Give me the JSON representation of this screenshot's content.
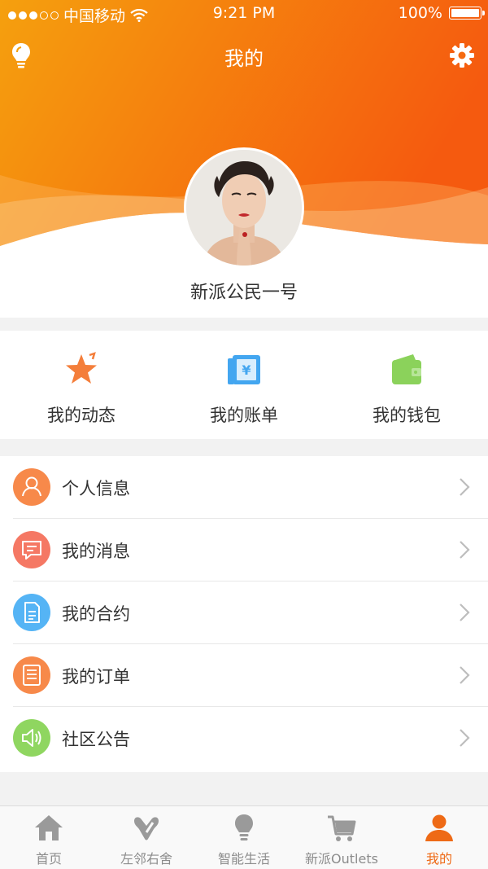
{
  "status_bar": {
    "carrier": "中国移动",
    "time": "9:21 PM",
    "battery": "100%"
  },
  "header": {
    "title": "我的",
    "left_icon": "lightbulb-icon",
    "right_icon": "gear-icon",
    "username": "新派公民一号",
    "gradient_start": "#f5a00e",
    "gradient_end": "#f55a0f"
  },
  "quick_actions": [
    {
      "label": "我的动态",
      "icon": "star-icon",
      "color": "#f47e3a"
    },
    {
      "label": "我的账单",
      "icon": "bill-icon",
      "color": "#43a6f0"
    },
    {
      "label": "我的钱包",
      "icon": "wallet-icon",
      "color": "#8bd25b"
    }
  ],
  "menu": [
    {
      "label": "个人信息",
      "icon": "person-icon",
      "color": "#f7894a"
    },
    {
      "label": "我的消息",
      "icon": "message-icon",
      "color": "#f57864"
    },
    {
      "label": "我的合约",
      "icon": "document-icon",
      "color": "#55b4f5"
    },
    {
      "label": "我的订单",
      "icon": "order-icon",
      "color": "#f7894a"
    },
    {
      "label": "社区公告",
      "icon": "speaker-icon",
      "color": "#8fd660"
    }
  ],
  "tabs": [
    {
      "label": "首页",
      "icon": "home-icon",
      "active": false
    },
    {
      "label": "左邻右舍",
      "icon": "neighbor-icon",
      "active": false
    },
    {
      "label": "智能生活",
      "icon": "smart-bulb-icon",
      "active": false
    },
    {
      "label": "新派Outlets",
      "icon": "cart-icon",
      "active": false
    },
    {
      "label": "我的",
      "icon": "profile-icon",
      "active": true
    }
  ],
  "colors": {
    "accent": "#ee6a16",
    "tab_inactive": "#9a9a9a"
  }
}
